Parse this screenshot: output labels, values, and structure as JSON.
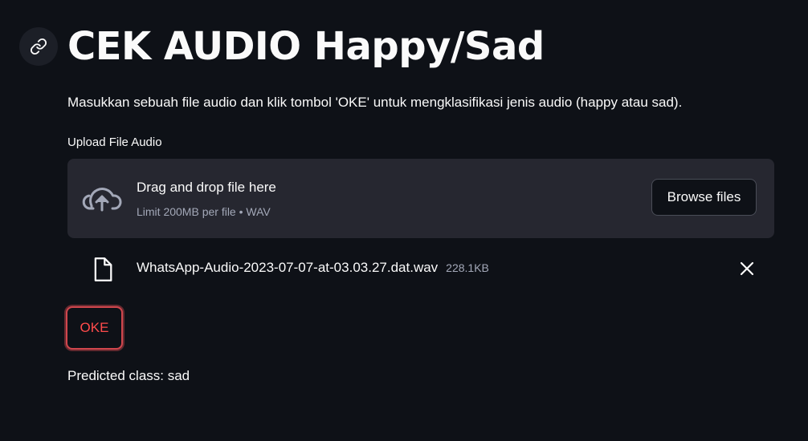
{
  "header": {
    "title": "CEK AUDIO Happy/Sad",
    "anchor_icon": "link-icon"
  },
  "description": "Masukkan sebuah file audio dan klik tombol 'OKE' untuk mengklasifikasi jenis audio (happy atau sad).",
  "uploader": {
    "label": "Upload File Audio",
    "drag_text": "Drag and drop file here",
    "limit_text": "Limit 200MB per file • WAV",
    "browse_label": "Browse files",
    "icon": "cloud-upload-icon"
  },
  "uploaded_file": {
    "name": "WhatsApp-Audio-2023-07-07-at-03.03.27.dat.wav",
    "size": "228.1KB",
    "icon": "file-icon",
    "remove_icon": "close-icon"
  },
  "oke_button": {
    "label": "OKE"
  },
  "result": {
    "text": "Predicted class: sad"
  },
  "colors": {
    "background": "#0e1117",
    "panel": "#262730",
    "accent": "#ff4b4b",
    "muted_text": "#a3a8b8"
  }
}
